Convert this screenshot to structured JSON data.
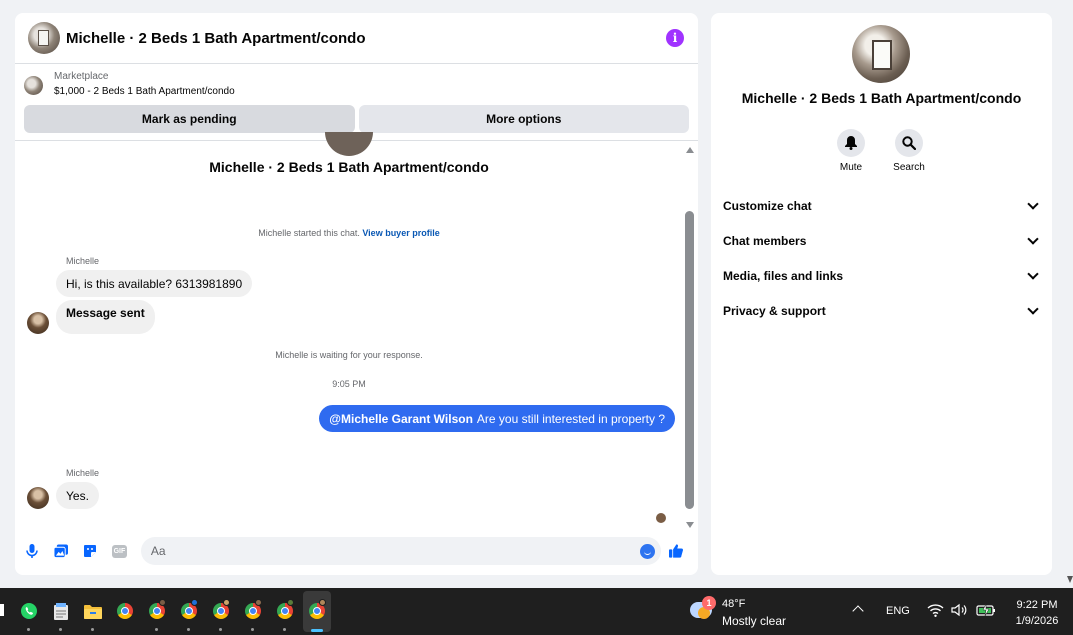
{
  "chat": {
    "title": "Michelle · 2 Beds 1 Bath Apartment/condo",
    "marketplace": {
      "label": "Marketplace",
      "listing": "$1,000 - 2 Beds 1 Bath Apartment/condo",
      "mark_pending": "Mark as pending",
      "more_options": "More options"
    },
    "conversation_name": "Michelle · 2 Beds 1 Bath Apartment/condo",
    "started_text": "Michelle started this chat.",
    "buyer_profile_link": "View buyer profile",
    "messages": [
      {
        "sender": "Michelle",
        "text": "Hi, is this available? 6313981890"
      },
      {
        "text": "Message sent"
      }
    ],
    "waiting_text": "Michelle is waiting for your response.",
    "timestamp": "9:05 PM",
    "outgoing": {
      "mention": "@Michelle Garant Wilson",
      "text": "Are you still interested in property ?"
    },
    "reply": {
      "sender": "Michelle",
      "text": "Yes."
    },
    "composer_placeholder": "Aa"
  },
  "side": {
    "name": "Michelle · 2 Beds 1 Bath Apartment/condo",
    "actions": {
      "mute": "Mute",
      "search": "Search"
    },
    "sections": [
      "Customize chat",
      "Chat members",
      "Media, files and links",
      "Privacy & support"
    ]
  },
  "taskbar": {
    "weather_badge": "1",
    "temperature": "48°F",
    "weather_desc": "Mostly clear",
    "language": "ENG",
    "time": "9:22 PM",
    "date": "1/9/2026"
  },
  "colors": {
    "accent": "#2f6bf0",
    "info": "#a033ff",
    "link": "#0a58b4"
  }
}
